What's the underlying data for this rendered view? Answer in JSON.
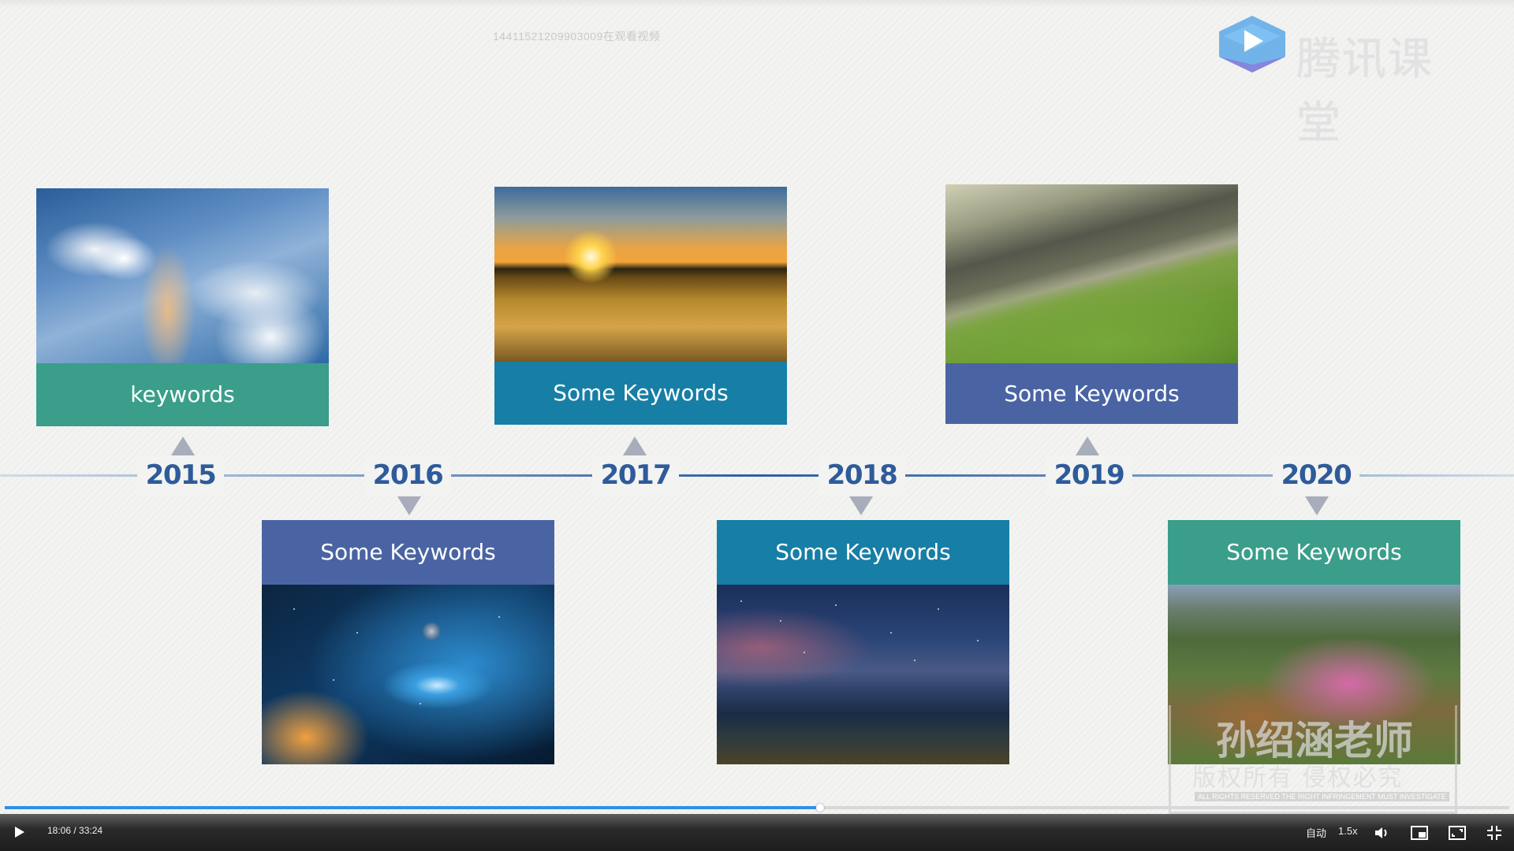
{
  "overlay": {
    "viewer_id_text": "14411521209903009在观看视频"
  },
  "brand": {
    "name": "腾讯课堂"
  },
  "timeline": {
    "years": [
      "2015",
      "2016",
      "2017",
      "2018",
      "2019",
      "2020"
    ],
    "cards": [
      {
        "year": "2015",
        "label": "keywords",
        "color": "#3a9e8a"
      },
      {
        "year": "2016",
        "label": "Some Keywords",
        "color": "#4a64a3"
      },
      {
        "year": "2017",
        "label": "Some Keywords",
        "color": "#177ea5"
      },
      {
        "year": "2018",
        "label": "Some Keywords",
        "color": "#177ea5"
      },
      {
        "year": "2019",
        "label": "Some Keywords",
        "color": "#4a64a3"
      },
      {
        "year": "2020",
        "label": "Some Keywords",
        "color": "#3a9e8a"
      }
    ]
  },
  "watermark": {
    "author": "孙绍涵老师",
    "rights": "版权所有 侵权必究",
    "rights_en": "ALL RIGHTS RESERVED THE RIGHT INFRINGEMENT MUST INVESTIGATE"
  },
  "player": {
    "time": "18:06 / 33:24",
    "progress_fraction": 0.5419,
    "quality": "自动",
    "speed": "1.5x",
    "icons": [
      "play-icon",
      "volume-icon",
      "picture-in-picture-icon",
      "web-fullscreen-icon",
      "exit-fullscreen-icon"
    ],
    "accent_color": "#2f8fe6"
  }
}
